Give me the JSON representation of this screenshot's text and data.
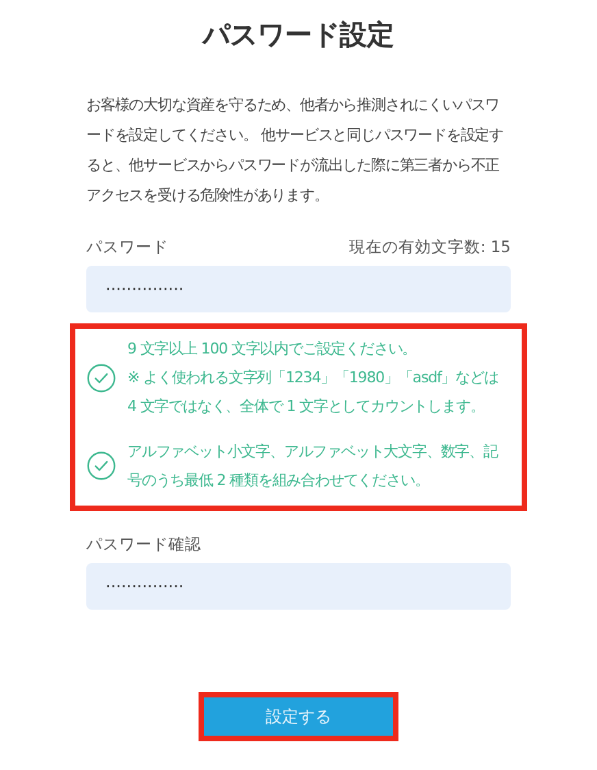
{
  "title": "パスワード設定",
  "description": "お客様の大切な資産を守るため、他者から推測されにくいパスワードを設定してください。 他サービスと同じパスワードを設定すると、他サービスからパスワードが流出した際に第三者から不正アクセスを受ける危険性があります。",
  "password": {
    "label": "パスワード",
    "counter": "現在の有効文字数: 15",
    "value": "···············"
  },
  "rules": [
    {
      "text": "9 文字以上 100 文字以内でご設定ください。\n※ よく使われる文字列「1234」「1980」「asdf」などは 4 文字ではなく、全体で 1 文字としてカウントします。",
      "met": true
    },
    {
      "text": "アルファベット小文字、アルファベット大文字、数字、記号のうち最低 2 種類を組み合わせてください。",
      "met": true
    }
  ],
  "confirm": {
    "label": "パスワード確認",
    "value": "···············"
  },
  "submit_button": "設定する"
}
